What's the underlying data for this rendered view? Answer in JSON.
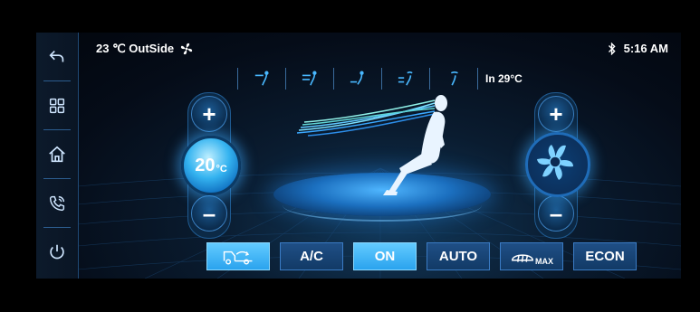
{
  "status": {
    "outside_temp": "23 ℃ OutSide",
    "time": "5:16 AM"
  },
  "sidebar": {
    "items": [
      {
        "icon": "back-icon"
      },
      {
        "icon": "apps-grid-icon"
      },
      {
        "icon": "home-icon"
      },
      {
        "icon": "phone-icon"
      },
      {
        "icon": "power-icon"
      }
    ]
  },
  "airflow_modes": {
    "items": [
      {
        "icon": "airflow-face-icon"
      },
      {
        "icon": "airflow-face-body-icon"
      },
      {
        "icon": "airflow-feet-icon"
      },
      {
        "icon": "airflow-feet-defrost-icon"
      },
      {
        "icon": "airflow-defrost-icon"
      }
    ],
    "inside_temp": "In 29°C"
  },
  "temperature": {
    "value": "20",
    "unit": "°C",
    "plus": "+",
    "minus": "–"
  },
  "fan": {
    "plus": "+",
    "minus": "–"
  },
  "bottom": {
    "recirc_icon": "recirculation-icon",
    "ac_label": "A/C",
    "on_label": "ON",
    "auto_label": "AUTO",
    "max_defrost_label": "MAX",
    "econ_label": "ECON"
  },
  "colors": {
    "accent": "#2aa3ee",
    "button_bg": "#1f4f86",
    "background": "#050c18"
  }
}
